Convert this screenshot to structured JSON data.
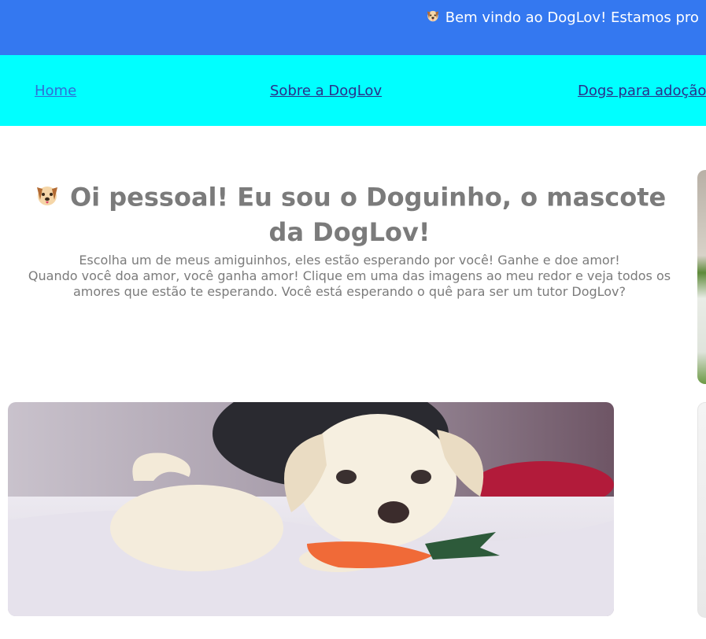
{
  "banner": {
    "marquee_text": "Bem vindo ao DogLov! Estamos pro"
  },
  "nav": {
    "home": "Home",
    "about": "Sobre a DogLov",
    "adopt": "Dogs para adoção"
  },
  "hero": {
    "title": "Oi pessoal! Eu sou o Doguinho, o mascote da DogLov!",
    "line1": "Escolha um de meus amiguinhos, eles estão esperando por você! Ganhe e doe amor!",
    "line2": "Quando você doa amor, você ganha amor! Clique em uma das imagens ao meu redor e veja todos os amores que estão te esperando. Você está esperando o quê para ser um tutor DogLov?"
  },
  "icons": {
    "banner_icon": "dog-face-icon",
    "title_icon": "dog-face-icon"
  },
  "colors": {
    "banner_bg": "#3478f0",
    "nav_bg": "#00ffff",
    "text_gray": "#7b7b7b"
  }
}
